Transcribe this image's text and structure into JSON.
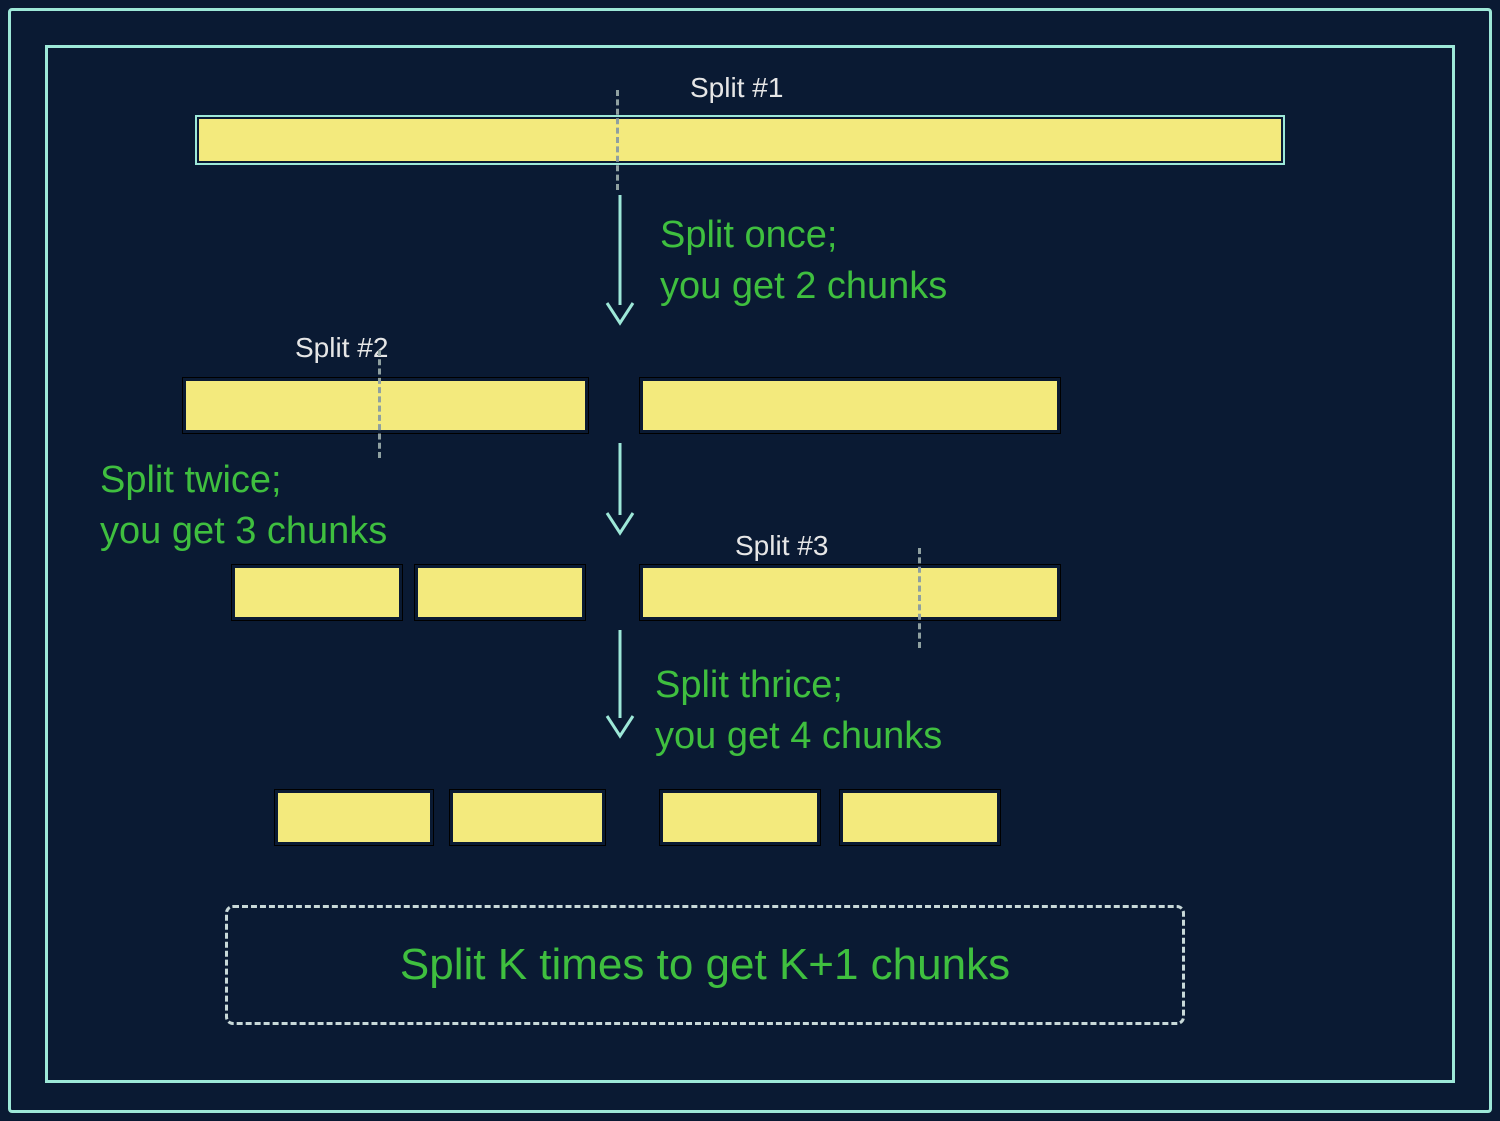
{
  "labels": {
    "split1": "Split #1",
    "split2": "Split #2",
    "split3": "Split #3"
  },
  "captions": {
    "once": "Split once;\nyou get 2 chunks",
    "twice": "Split twice;\nyou get 3 chunks",
    "thrice": "Split thrice;\nyou get 4 chunks"
  },
  "conclusion": "Split K times to get K+1 chunks",
  "colors": {
    "background": "#0a1a33",
    "frame": "#9de8d8",
    "bar": "#f3ea7d",
    "green": "#3fbf3f",
    "dash": "#8fa0a0",
    "white": "#e6e6e6"
  }
}
